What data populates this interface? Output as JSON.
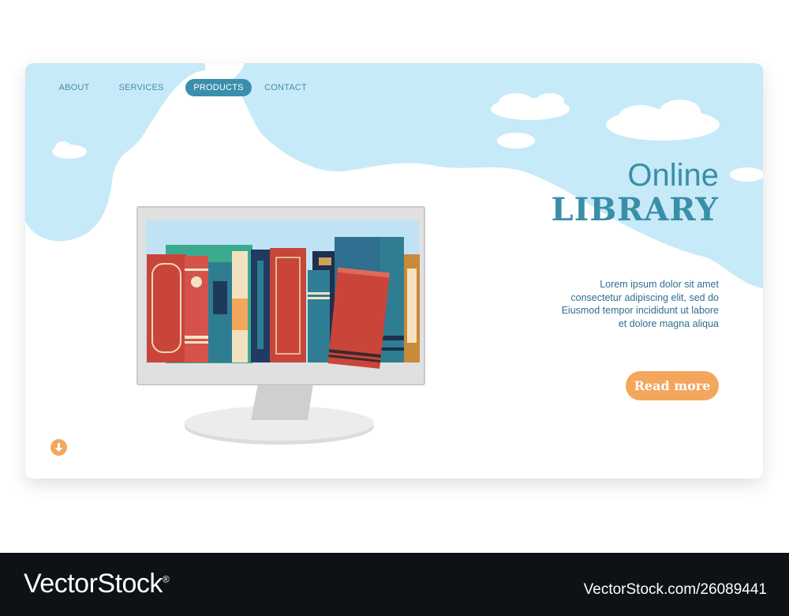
{
  "nav": {
    "items": [
      {
        "label": "ABOUT",
        "active": false
      },
      {
        "label": "SERVICES",
        "active": false
      },
      {
        "label": "PRODUCTS",
        "active": true
      },
      {
        "label": "CONTACT",
        "active": false
      }
    ]
  },
  "hero": {
    "title_line1": "Online",
    "title_line2": "LIBRARY",
    "description_lines": [
      "Lorem ipsum dolor sit amet",
      "consectetur adipiscing elit, sed do",
      "Eiusmod tempor incididunt ut labore",
      "et dolore magna aliqua"
    ],
    "cta_label": "Read more"
  },
  "icons": {
    "scroll_down": "arrow-down-icon",
    "illustration": "monitor-with-books-icon"
  },
  "colors": {
    "sky": "#c6eaf8",
    "accent_text": "#3a8ea8",
    "nav_active": "#3b8fad",
    "cta": "#f3a65c"
  },
  "footer": {
    "brand": "VectorStock",
    "registered_mark": "®",
    "image_id": "VectorStock.com/26089441"
  }
}
